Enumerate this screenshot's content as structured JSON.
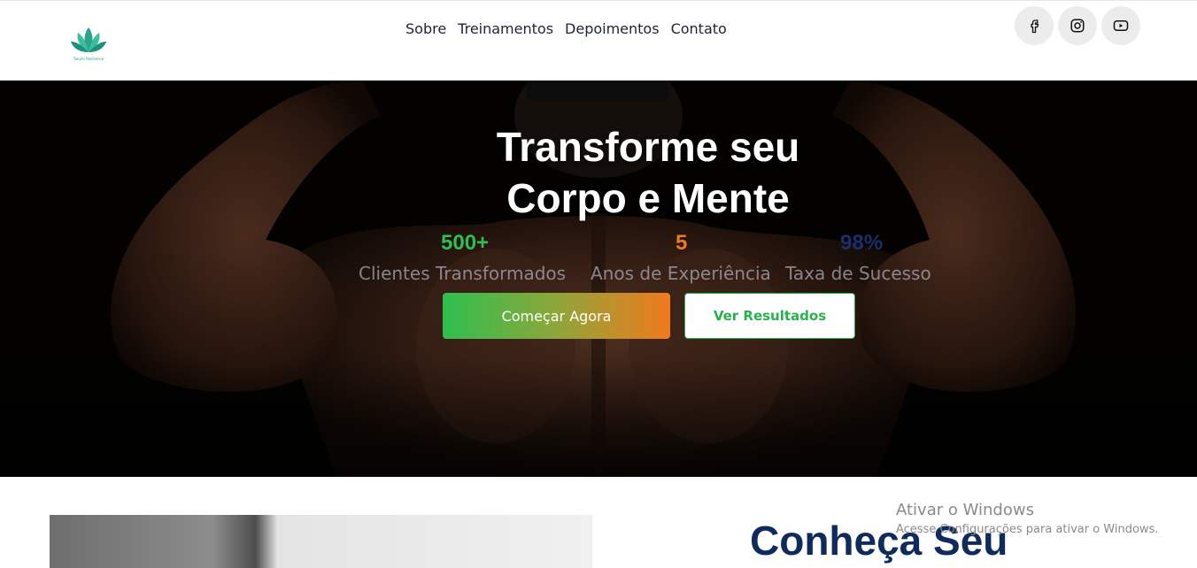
{
  "header": {
    "logo_text": "Tanjiro Resilience",
    "nav": [
      "Sobre",
      "Treinamentos",
      "Depoimentos",
      "Contato"
    ],
    "socials": [
      "facebook-icon",
      "instagram-icon",
      "youtube-icon"
    ]
  },
  "hero": {
    "title_line1": "Transforme seu",
    "title_line2": "Corpo e Mente",
    "stats": [
      {
        "number": "500+",
        "label": "Clientes Transformados",
        "color": "#2fbf4f"
      },
      {
        "number": "5",
        "label": "Anos de Experiência",
        "color": "#f07a1d"
      },
      {
        "number": "98%",
        "label": "Taxa de Sucesso",
        "color": "#1a2f6b"
      }
    ],
    "primary_button": "Começar Agora",
    "secondary_button": "Ver Resultados"
  },
  "about": {
    "title": "Conheça Seu"
  },
  "watermark": {
    "title": "Ativar o Windows",
    "subtitle": "Acesse Configurações para ativar o Windows."
  },
  "colors": {
    "brand_green": "#27b24d",
    "brand_orange": "#f07a1d",
    "navy": "#0f2a5c"
  }
}
